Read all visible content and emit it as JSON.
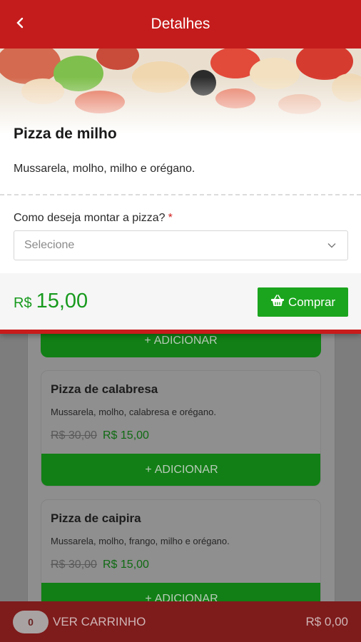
{
  "header": {
    "title": "Detalhes",
    "back_icon": "chevron-left-icon"
  },
  "product": {
    "name": "Pizza de milho",
    "description": "Mussarela, molho, milho e orégano."
  },
  "option": {
    "label": "Como deseja montar a pizza?",
    "required_mark": "*",
    "placeholder": "Selecione"
  },
  "price": {
    "currency": "R$",
    "value": "15,00"
  },
  "buy_button": {
    "label": "Comprar",
    "icon": "basket-icon"
  },
  "list": {
    "add_label": "ADICIONAR",
    "items": [
      {
        "name": "Pizza de calabresa",
        "description": "Mussarela, molho, calabresa e orégano.",
        "old_price": "R$ 30,00",
        "price": "R$ 15,00"
      },
      {
        "name": "Pizza de caipira",
        "description": "Mussarela, molho, frango, milho e orégano.",
        "old_price": "R$ 30,00",
        "price": "R$ 15,00"
      }
    ]
  },
  "cart": {
    "count": "0",
    "label": "VER CARRINHO",
    "total": "R$ 0,00"
  },
  "colors": {
    "brand_red": "#c41c1c",
    "price_green": "#179a1d",
    "button_green": "#1ba51e"
  }
}
